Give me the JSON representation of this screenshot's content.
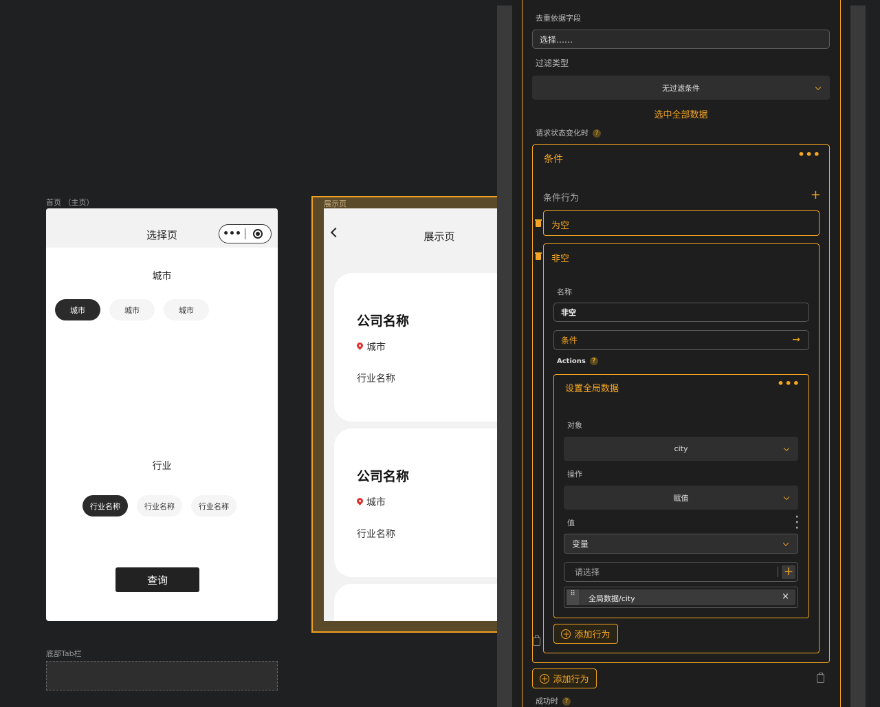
{
  "home": {
    "caption": "首页 （主页）",
    "title": "选择页",
    "capsule_more": "•••",
    "city_section": "城市",
    "city_chips": [
      "城市",
      "城市",
      "城市"
    ],
    "industry_section": "行业",
    "industry_chips": [
      "行业名称",
      "行业名称",
      "行业名称"
    ],
    "query_button": "查询"
  },
  "display": {
    "caption": "展示页",
    "title": "展示页",
    "cards": [
      {
        "company": "公司名称",
        "city": "城市",
        "industry": "行业名称"
      },
      {
        "company": "公司名称",
        "city": "城市",
        "industry": "行业名称"
      }
    ]
  },
  "tabbar": {
    "caption": "底部Tab栏"
  },
  "panel": {
    "dedupe_label": "去重依据字段",
    "dedupe_placeholder": "选择……",
    "filter_label": "过滤类型",
    "filter_value": "无过滤条件",
    "select_all": "选中全部数据",
    "state_change_label": "请求状态变化时",
    "condition_title": "条件",
    "condition_behavior": "条件行为",
    "branch_empty": "为空",
    "branch_not_empty": "非空",
    "name_label": "名称",
    "name_value": "非空",
    "condition_link": "条件",
    "actions_label": "Actions",
    "action_title": "设置全局数据",
    "object_label": "对象",
    "object_value": "city",
    "op_label": "操作",
    "op_value": "赋值",
    "value_label": "值",
    "value_type": "变量",
    "value_placeholder": "请选择",
    "value_tag": "全局数据/city",
    "tag_close": "×",
    "add_action_inner": "添加行为",
    "add_action_outer": "添加行为",
    "success_label": "成功时",
    "qmark": "?"
  },
  "colors": {
    "accent": "#f5a623",
    "background": "#1f2022",
    "panel": "#1e1e1e"
  }
}
